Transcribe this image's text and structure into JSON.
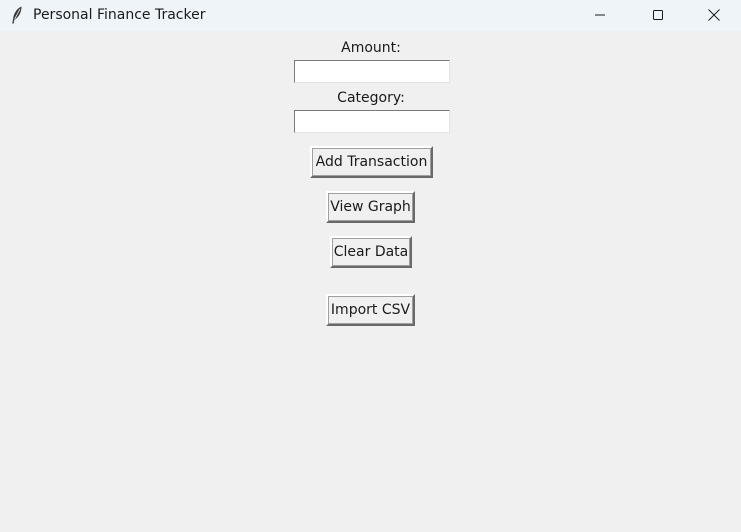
{
  "window": {
    "title": "Personal Finance Tracker",
    "icon": "feather-icon",
    "controls": [
      "minimize-icon",
      "maximize-icon",
      "close-icon"
    ]
  },
  "form": {
    "amount_label": "Amount:",
    "amount_value": "",
    "category_label": "Category:",
    "category_value": ""
  },
  "buttons": {
    "add_transaction": "Add Transaction",
    "view_graph": "View Graph",
    "clear_data": "Clear Data",
    "import_csv": "Import CSV"
  },
  "colors": {
    "titlebar": "#eff4f9",
    "window_bg": "#f0f0f0",
    "entry_bg": "#ffffff"
  }
}
